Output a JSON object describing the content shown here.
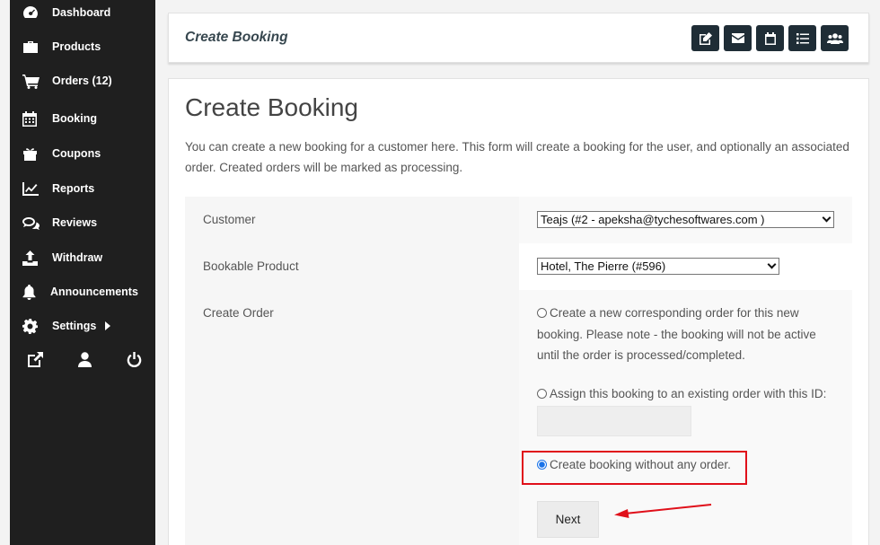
{
  "sidebar": {
    "items": [
      {
        "label": "Dashboard",
        "icon": "dashboard-icon"
      },
      {
        "label": "Products",
        "icon": "briefcase-icon"
      },
      {
        "label": "Orders (12)",
        "icon": "cart-icon"
      },
      {
        "label": "Booking",
        "icon": "calendar-icon"
      },
      {
        "label": "Coupons",
        "icon": "gift-icon"
      },
      {
        "label": "Reports",
        "icon": "chart-icon"
      },
      {
        "label": "Reviews",
        "icon": "comments-icon"
      },
      {
        "label": "Withdraw",
        "icon": "upload-icon"
      },
      {
        "label": "Announcements",
        "icon": "bell-icon"
      },
      {
        "label": "Settings",
        "icon": "gear-icon"
      }
    ],
    "bottom_icons": [
      "external-link-icon",
      "user-icon",
      "power-icon"
    ]
  },
  "header": {
    "title": "Create Booking",
    "buttons": [
      "edit-icon",
      "envelope-icon",
      "calendar-icon",
      "list-icon",
      "users-icon"
    ]
  },
  "main": {
    "title": "Create Booking",
    "intro": "You can create a new booking for a customer here. This form will create a booking for the user, and optionally an associated order. Created orders will be marked as processing.",
    "form": {
      "customer_label": "Customer",
      "customer_value": "Teajs (#2 - apeksha@tychesoftwares.com )",
      "product_label": "Bookable Product",
      "product_value": "Hotel, The Pierre (#596)",
      "order_label": "Create Order",
      "option_new_line1": "Create a new corresponding order for this new",
      "option_new_line2": "booking. Please note - the booking will not be active",
      "option_new_line3": "until the order is processed/completed.",
      "option_existing": "Assign this booking to an existing order with this ID:",
      "existing_order_id": "",
      "option_none": "Create booking without any order.",
      "selected_option": "none",
      "next_label": "Next"
    }
  },
  "colors": {
    "sidebar_bg": "#1f1f1f",
    "header_button_bg": "#1f2d36",
    "highlight": "#e0101a"
  }
}
